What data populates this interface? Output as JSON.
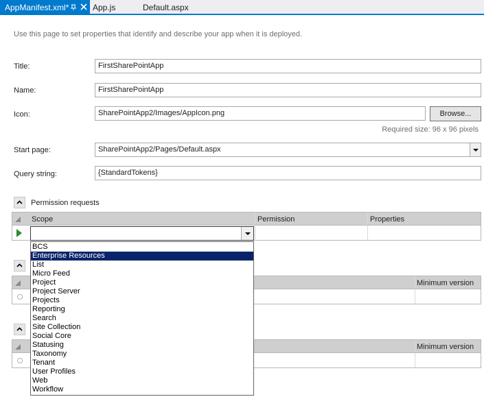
{
  "tabs": [
    {
      "label": "AppManifest.xml*",
      "active": true
    },
    {
      "label": "App.js",
      "active": false
    },
    {
      "label": "Default.aspx",
      "active": false
    }
  ],
  "intro_text": "Use this page to set properties that identify and describe your app when it is deployed.",
  "form": {
    "title_label": "Title:",
    "title_value": "FirstSharePointApp",
    "name_label": "Name:",
    "name_value": "FirstSharePointApp",
    "icon_label": "Icon:",
    "icon_value": "SharePointApp2/Images/AppIcon.png",
    "browse_label": "Browse...",
    "icon_hint": "Required size: 96 x 96 pixels",
    "start_page_label": "Start page:",
    "start_page_value": "SharePointApp2/Pages/Default.aspx",
    "query_label": "Query string:",
    "query_value": "{StandardTokens}"
  },
  "permissions": {
    "title": "Permission requests",
    "columns": [
      "Scope",
      "Permission",
      "Properties"
    ],
    "scope_value": ""
  },
  "grid2": {
    "column": "Minimum version"
  },
  "grid3": {
    "column": "Minimum version"
  },
  "scope_options": [
    "BCS",
    "Enterprise Resources",
    "List",
    "Micro Feed",
    "Project",
    "Project Server",
    "Projects",
    "Reporting",
    "Search",
    "Site Collection",
    "Social Core",
    "Statusing",
    "Taxonomy",
    "Tenant",
    "User Profiles",
    "Web",
    "Workflow"
  ],
  "selected_option": "Enterprise Resources",
  "colors": {
    "accent": "#007acc",
    "selection": "#0a246a"
  }
}
